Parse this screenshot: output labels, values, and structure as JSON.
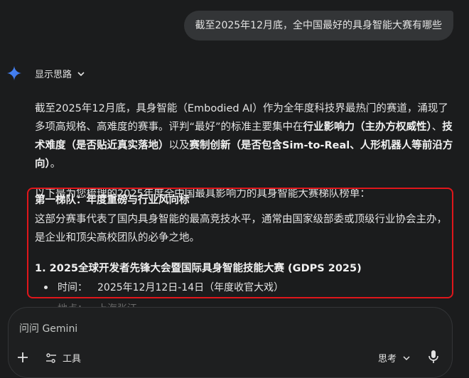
{
  "user_message": "截至2025年12月底，全中国最好的具身智能大赛有哪些",
  "thinking_toggle": "显示思路",
  "response": {
    "intro_parts": [
      "截至2025年12月底，具身智能（Embodied AI）作为全年度科技界最热门的赛道，涌现了多项高规格、高难度的赛事。评判“最好”的标准主要集中在",
      "行业影响力（主办方权威性）",
      "、",
      "技术难度（是否贴近真实落地）",
      "以及",
      "赛制创新（是否包含Sim-to-Real、人形机器人等前沿方向）",
      "。"
    ],
    "subtitle": "以下是为您梳理的2025年度全中国最具影响力的具身智能大赛梯队榜单：",
    "tier1": {
      "title": "第一梯队：年度重磅与行业风向标",
      "description": "这部分赛事代表了国内具身智能的最高竞技水平，通常由国家级部委或顶级行业协会主办，是企业和顶尖高校团队的必争之地。",
      "item1_title": "1. 2025全球开发者先锋大会暨国际具身智能技能大赛 (GDPS 2025)",
      "time_label": "时间：",
      "time_value": "2025年12月12日-14日（年度收官大戏）",
      "location_label": "地点：",
      "location_value": "上海张江"
    }
  },
  "input": {
    "placeholder": "问问 Gemini",
    "tools_label": "工具",
    "model_label": "思考"
  },
  "colors": {
    "background": "#1b1c1d",
    "bubble": "#333537",
    "highlight_border": "#e0161b",
    "gemini_blue": "#4a8cff"
  }
}
